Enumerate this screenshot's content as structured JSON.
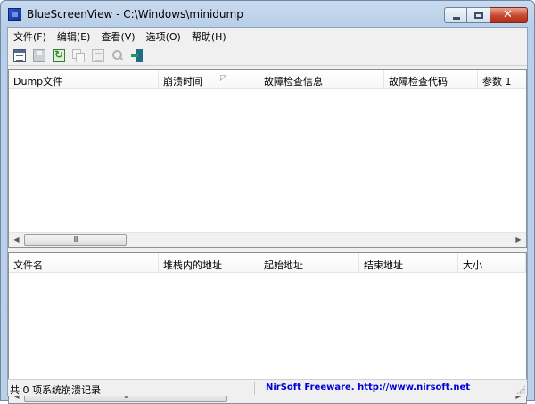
{
  "window": {
    "title": "BlueScreenView  -  C:\\Windows\\minidump"
  },
  "menu": [
    "文件(F)",
    "编辑(E)",
    "查看(V)",
    "选项(O)",
    "帮助(H)"
  ],
  "toolbar": {
    "buttons": [
      "properties-icon",
      "save-icon",
      "refresh-icon",
      "copy-icon",
      "html-report-icon",
      "find-icon",
      "exit-icon"
    ]
  },
  "top_table": {
    "columns": [
      "Dump文件",
      "崩溃时间",
      "故障检查信息",
      "故障检查代码",
      "参数 1"
    ],
    "sorted_column": "崩溃时间",
    "rows": []
  },
  "bottom_table": {
    "columns": [
      "文件名",
      "堆栈内的地址",
      "起始地址",
      "结束地址",
      "大小"
    ],
    "rows": []
  },
  "scrollbar": {
    "grip_label": "III"
  },
  "status": {
    "count_text": "共 0 项系统崩溃记录",
    "link_text": "NirSoft Freeware.  http://www.nirsoft.net"
  },
  "colors": {
    "link": "#0000d8",
    "title_bar": "#c9daee",
    "close_button": "#c7452f"
  }
}
